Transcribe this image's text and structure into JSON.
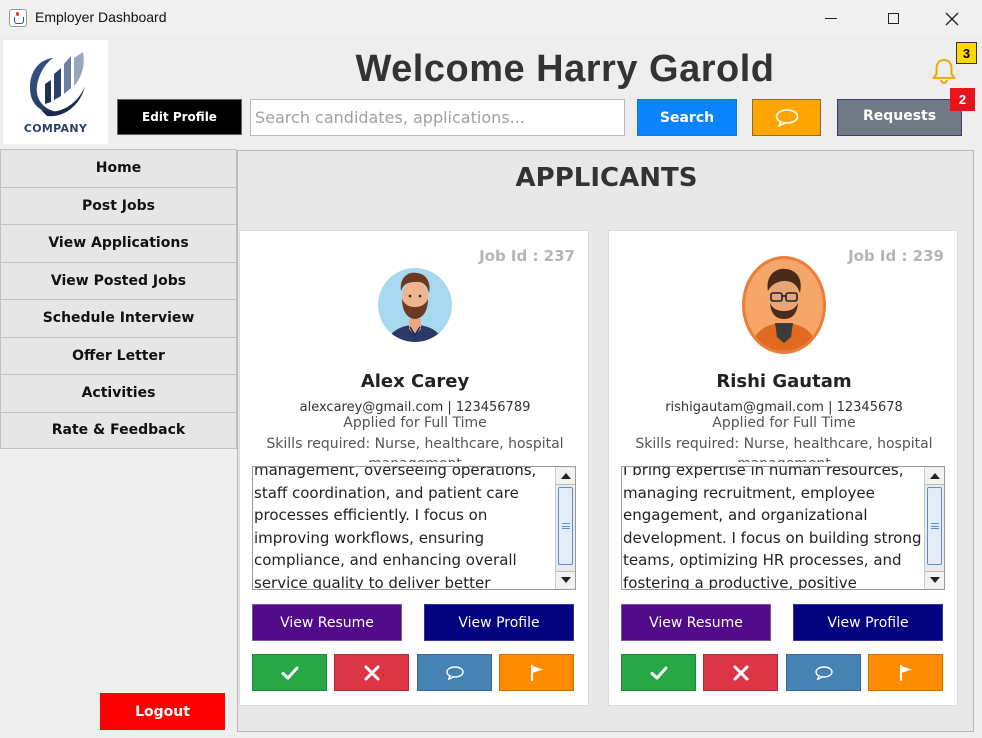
{
  "window": {
    "title": "Employer Dashboard",
    "icon": "java-cup-icon"
  },
  "header": {
    "logo_text": "COMPANY",
    "welcome": "Welcome Harry Garold",
    "notification_count": "3",
    "requests_count": "2",
    "edit_profile_label": "Edit Profile",
    "search_placeholder": "Search candidates, applications...",
    "search_label": "Search",
    "requests_label": "Requests",
    "colors": {
      "search": "#0a84ff",
      "chat": "#ffa500",
      "requests": "#707a84",
      "logout": "#ff0000"
    }
  },
  "sidebar": {
    "items": [
      {
        "label": "Home"
      },
      {
        "label": "Post Jobs"
      },
      {
        "label": "View Applications"
      },
      {
        "label": "View Posted Jobs"
      },
      {
        "label": "Schedule Interview"
      },
      {
        "label": "Offer Letter"
      },
      {
        "label": "Activities"
      },
      {
        "label": "Rate & Feedback"
      }
    ],
    "logout_label": "Logout"
  },
  "main": {
    "title": "APPLICANTS",
    "candidates": [
      {
        "job_id": "Job Id : 237",
        "name": "Alex Carey",
        "contact": "alexcarey@gmail.com | 123456789",
        "applied": "Applied for Full Time",
        "skills": "Skills required: Nurse, healthcare, hospital management",
        "bio": "management, overseeing operations, staff coordination, and patient care processes efficiently. I focus on improving workflows, ensuring compliance, and enhancing overall service quality to deliver better healthcare outcomes.",
        "view_resume": "View Resume",
        "view_profile": "View Profile"
      },
      {
        "job_id": "Job Id : 239",
        "name": "Rishi Gautam",
        "contact": "rishigautam@gmail.com | 12345678",
        "applied": "Applied for Full Time",
        "skills": "Skills required: Nurse, healthcare, hospital management",
        "bio": "I bring expertise in human resources, managing recruitment, employee engagement, and organizational development. I focus on building strong teams, optimizing HR processes, and fostering a productive, positive workplace",
        "view_resume": "View Resume",
        "view_profile": "View Profile"
      }
    ],
    "action_icons": [
      "check-icon",
      "x-icon",
      "chat-bubble-icon",
      "flag-icon"
    ],
    "action_colors": {
      "accept": "#28a745",
      "reject": "#dc3545",
      "message": "#4682b4",
      "flag": "#ff8c00",
      "resume": "#500a8a",
      "profile": "#030380"
    }
  }
}
